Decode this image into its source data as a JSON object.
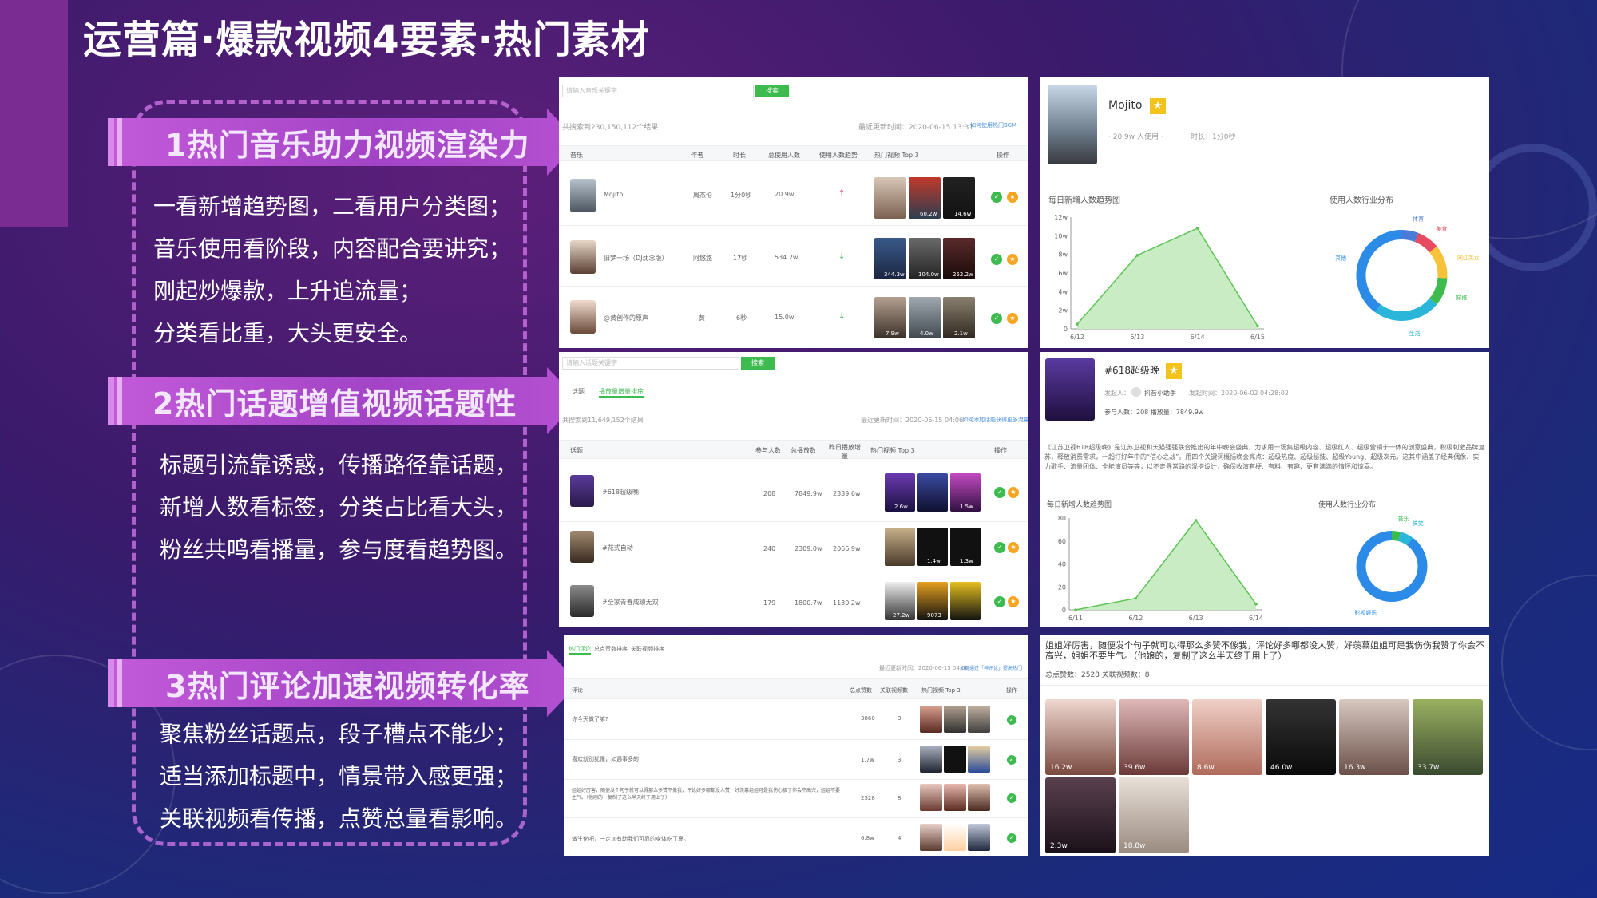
{
  "title": "运营篇·爆款视频4要素·热门素材",
  "sections": [
    {
      "heading": "1热门音乐助力视频渲染力",
      "lines": [
        "一看新增趋势图，二看用户分类图；",
        "音乐使用看阶段，内容配合要讲究；",
        "刚起炒爆款，上升追流量；",
        "分类看比重，大头更安全。"
      ]
    },
    {
      "heading": "2热门话题增值视频话题性",
      "lines": [
        "标题引流靠诱惑，传播路径靠话题，",
        "新增人数看标签，分类占比看大头，",
        "粉丝共鸣看播量，参与度看趋势图。"
      ]
    },
    {
      "heading": "3热门评论加速视频转化率",
      "lines": [
        "聚焦粉丝话题点，段子槽点不能少；",
        "适当添加标题中，情景带入感更强；",
        "关联视频看传播，点赞总量看影响。"
      ]
    }
  ],
  "music_list": {
    "search_placeholder": "请输入音乐关键字",
    "search_btn": "搜索",
    "total": "共搜索到230,150,112个结果",
    "updated": "最近更新时间：2020-06-15 13:31",
    "help": "如何使用热门BGM",
    "headers": [
      "音乐",
      "作者",
      "时长",
      "总使用人数",
      "使用人数趋势",
      "热门视频 Top 3",
      "操作"
    ],
    "rows": [
      {
        "name": "Mojito",
        "author": "周杰伦",
        "duration": "1分0秒",
        "users": "20.9w",
        "trend": "↑",
        "thumbs": [
          "",
          "60.2w",
          "14.6w"
        ]
      },
      {
        "name": "旧梦一场（DJ沈念版）",
        "author": "阿悠悠",
        "duration": "17秒",
        "users": "534.2w",
        "trend": "↓",
        "thumbs": [
          "344.3w",
          "104.0w",
          "252.2w"
        ]
      },
      {
        "name": "@黄创作的原声",
        "author": "黄",
        "duration": "6秒",
        "users": "15.0w",
        "trend": "↓",
        "thumbs": [
          "7.9w",
          "4.0w",
          "2.1w"
        ]
      }
    ]
  },
  "mojito": {
    "name": "Mojito",
    "meta": "· 20.9w 人使用 ·",
    "duration": "时长：1分0秒",
    "trend_title": "每日新增人数趋势图",
    "dist_title": "使用人数行业分布",
    "y_ticks": [
      "12w",
      "10w",
      "8w",
      "6w",
      "4w",
      "2w",
      "0"
    ],
    "chart_data": {
      "type": "area",
      "categories": [
        "6/12",
        "6/13",
        "6/14",
        "6/15"
      ],
      "values": [
        0.5,
        7.9,
        10.8,
        0.3
      ],
      "ylim": [
        0,
        12
      ]
    },
    "pie": {
      "labels": [
        "体育",
        "美食",
        "网红美女",
        "穿搭",
        "生活",
        "其他"
      ],
      "values": [
        6,
        8,
        12,
        10,
        24,
        40
      ],
      "colors": [
        "#4a7bd8",
        "#e84a5f",
        "#f6c33b",
        "#3dbb4f",
        "#29b6d8",
        "#2b8be6"
      ]
    }
  },
  "topic_list": {
    "search_placeholder": "请输入话题关键字",
    "search_btn": "搜索",
    "tabs": [
      "话题",
      "播放量增量排序"
    ],
    "total": "共搜索到11,649,152个结果",
    "updated": "最近更新时间：2020-06-15 04:06",
    "help": "如何添加话题获得更多流量",
    "headers": [
      "话题",
      "参与人数",
      "总播放数",
      "昨日播放增量",
      "热门视频 Top 3",
      "操作"
    ],
    "rows": [
      {
        "name": "#618超级晚",
        "participants": "208",
        "plays": "7849.9w",
        "incr": "2339.6w",
        "thumbs": [
          "2.6w",
          "",
          "1.5w"
        ]
      },
      {
        "name": "#花式自动",
        "participants": "240",
        "plays": "2309.0w",
        "incr": "2066.9w",
        "thumbs": [
          "",
          "1.4w",
          "1.3w"
        ]
      },
      {
        "name": "#全家青春成绩无双",
        "participants": "179",
        "plays": "1800.7w",
        "incr": "1130.2w",
        "thumbs": [
          "27.2w",
          "9073",
          ""
        ]
      }
    ]
  },
  "topic_detail": {
    "name": "#618超级晚",
    "creator": "发起人：",
    "creator_name": "抖音小助手",
    "created": "发起时间：2020-06-02 04:28:02",
    "stats": "参与人数：208  播放量：7849.9w",
    "desc": "《江苏卫视618超级晚》是江苏卫视和天猫强强联合推出的年中晚会盛典，力求用一场集超级内容、超级红人、超级营销于一体的创意盛典，积极刺激品牌复苏，释放消费需求，一起打好年中的“信心之战”。用四个关键词概括晚会亮点：超级热度、超级秘技、超级Young、超级次元。这其中涵盖了经典偶像、实力歌手、流量团体、全能演员等等，以不走寻常路的混搭设计，确保收演有梗、有料、有趣、更有满满的情怀和惊喜。",
    "trend_title": "每日新增人数趋势图",
    "dist_title": "使用人数行业分布",
    "y_ticks": [
      "80",
      "60",
      "40",
      "20",
      "0"
    ],
    "chart_data": {
      "type": "area",
      "categories": [
        "6/11",
        "6/12",
        "6/13",
        "6/14"
      ],
      "values": [
        0,
        10,
        78,
        5
      ],
      "ylim": [
        0,
        80
      ]
    },
    "pie": {
      "labels": [
        "音乐",
        "搞笑",
        "影视娱乐"
      ],
      "values": [
        4,
        6,
        90
      ],
      "colors": [
        "#3dbb4f",
        "#29b6d8",
        "#2b8be6"
      ]
    }
  },
  "comment_list": {
    "tabs": [
      "热门评论",
      "总点赞数排序",
      "关联视频排序"
    ],
    "updated": "最近更新时间：2020-06-15 04:06",
    "help": "如何通过「神评论」提高热门",
    "headers": [
      "评论",
      "总点赞数",
      "关联视频数",
      "热门视频 Top 3",
      "操作"
    ],
    "rows": [
      {
        "text": "你今天做了嘛?",
        "likes": "3860",
        "videos": "3"
      },
      {
        "text": "喜欢就别犹豫，如遇事多的",
        "likes": "1.7w",
        "videos": "3"
      },
      {
        "text": "姐姐好厉害，随便发个句子就可以得那么多赞不像我，评论好多哪都没人赞，好羡慕姐姐可是我伤心极了你会不高兴，姐姐不要生气。（他刚的，复制了这么半天终于用上了）",
        "likes": "2528",
        "videos": "8"
      },
      {
        "text": "做生化吧，一定加有助我们可靠的身体吃了夏。",
        "likes": "6.8w",
        "videos": "4"
      }
    ]
  },
  "comment_detail": {
    "text": "姐姐好厉害，随便发个句子就可以得那么多赞不像我，评论好多哪都没人赞，好羡慕姐姐可是我伤伤我赞了你会不高兴，姐姐不要生气。（他娘的，复制了这么半天终于用上了）",
    "stats": "总点赞数：2528  关联视频数：8",
    "videos": [
      "16.2w",
      "39.6w",
      "8.6w",
      "46.0w",
      "16.3w",
      "33.7w",
      "2.3w",
      "18.8w"
    ]
  }
}
